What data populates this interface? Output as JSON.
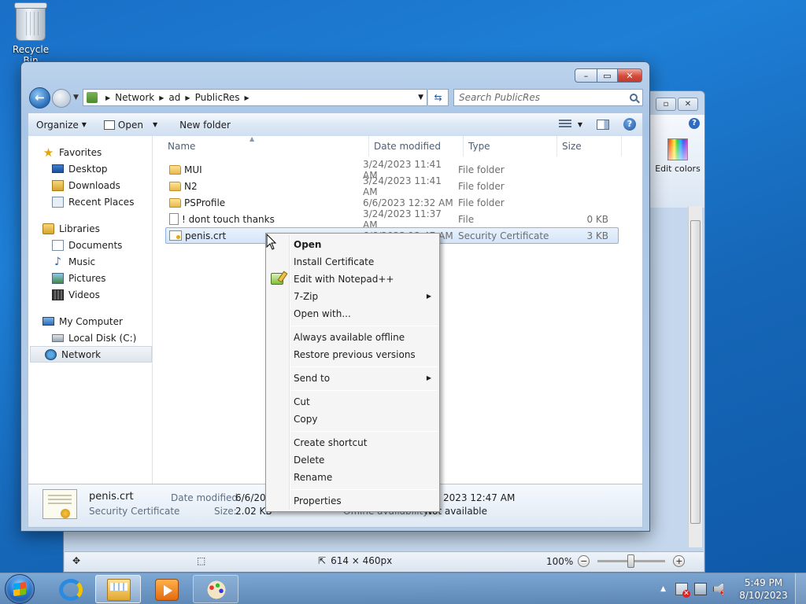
{
  "desktop": {
    "recycle_bin_label": "Recycle Bin"
  },
  "paint": {
    "ribbon_edit_colors": "Edit colors",
    "status_dimensions": "614 × 460px",
    "status_zoom": "100%",
    "zoom_level_percent": 100
  },
  "explorer": {
    "breadcrumb": [
      "Network",
      "ad",
      "PublicRes"
    ],
    "search_placeholder": "Search PublicRes",
    "toolbar": {
      "organize": "Organize",
      "open": "Open",
      "new_folder": "New folder"
    },
    "nav": {
      "favorites": "Favorites",
      "desktop": "Desktop",
      "downloads": "Downloads",
      "recent_places": "Recent Places",
      "libraries": "Libraries",
      "documents": "Documents",
      "music": "Music",
      "pictures": "Pictures",
      "videos": "Videos",
      "my_computer": "My Computer",
      "local_disk": "Local Disk (C:)",
      "network": "Network"
    },
    "columns": {
      "name": "Name",
      "date_modified": "Date modified",
      "type": "Type",
      "size": "Size"
    },
    "files": [
      {
        "name": "MUI",
        "date": "3/24/2023 11:41 AM",
        "type": "File folder",
        "size": "",
        "icon": "folder-icon"
      },
      {
        "name": "N2",
        "date": "3/24/2023 11:41 AM",
        "type": "File folder",
        "size": "",
        "icon": "folder-icon"
      },
      {
        "name": "PSProfile",
        "date": "6/6/2023 12:32 AM",
        "type": "File folder",
        "size": "",
        "icon": "folder-icon"
      },
      {
        "name": "! dont touch thanks",
        "date": "3/24/2023 11:37 AM",
        "type": "File",
        "size": "0 KB",
        "icon": "file-icon"
      },
      {
        "name": "penis.crt",
        "date": "6/6/2023 12:47 AM",
        "type": "Security Certificate",
        "size": "3 KB",
        "icon": "certificate-icon"
      }
    ],
    "details": {
      "name": "penis.crt",
      "type": "Security Certificate",
      "date_modified_label": "Date modified:",
      "date_modified_value": "6/6/2023",
      "size_label": "Size:",
      "size_value": "2.02 KB",
      "right_date_value": "2023 12:47 AM",
      "offline_label": "Offline availability:",
      "offline_value": "Not available"
    }
  },
  "context_menu": {
    "items": [
      {
        "label": "Open",
        "bold": true
      },
      {
        "label": "Install Certificate"
      },
      {
        "label": "Edit with Notepad++",
        "icon": "notepad-plus-plus-icon"
      },
      {
        "label": "7-Zip",
        "submenu": true
      },
      {
        "label": "Open with..."
      },
      {
        "label": "Always available offline"
      },
      {
        "label": "Restore previous versions"
      },
      {
        "label": "Send to",
        "submenu": true
      },
      {
        "label": "Cut"
      },
      {
        "label": "Copy"
      },
      {
        "label": "Create shortcut"
      },
      {
        "label": "Delete"
      },
      {
        "label": "Rename"
      },
      {
        "label": "Properties"
      }
    ]
  },
  "taskbar": {
    "clock_time": "5:49 PM",
    "clock_date": "8/10/2023"
  }
}
